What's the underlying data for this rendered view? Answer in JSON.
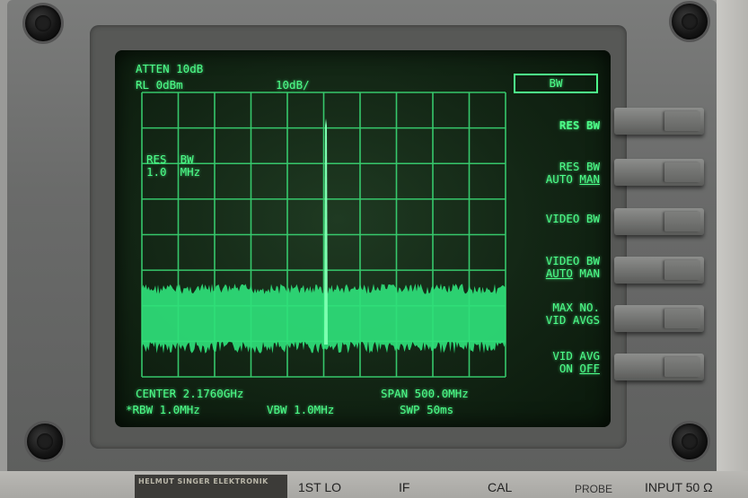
{
  "screen": {
    "atten": "ATTEN 10dB",
    "ref_level": "RL 0dBm",
    "scale": "10dB/",
    "marker_label_1": "RES  BW",
    "marker_label_2": "1.0  MHz",
    "center": "CENTER 2.1760GHz",
    "span": "SPAN 500.0MHz",
    "rbw": "*RBW 1.0MHz",
    "vbw": "VBW 1.0MHz",
    "sweep": "SWP 50ms"
  },
  "menu": {
    "title": "BW",
    "keys": [
      {
        "line1": "RES BW",
        "line2a": "",
        "line2b": ""
      },
      {
        "line1": "RES  BW",
        "line2a": "AUTO ",
        "line2b": "MAN"
      },
      {
        "line1": "VIDEO BW",
        "line2a": "",
        "line2b": ""
      },
      {
        "line1": "VIDEO BW",
        "line2a": "AUTO",
        "line2b": " MAN"
      },
      {
        "line1": "MAX NO.",
        "line2a": "VID AVGS",
        "line2b": ""
      },
      {
        "line1": "VID  AVG",
        "line2a": "ON  ",
        "line2b": "OFF"
      }
    ]
  },
  "panel": {
    "badge": "HELMUT SINGER ELEKTRONIK",
    "connectors": [
      "1ST LO",
      "IF",
      "CAL",
      "PROBE",
      "INPUT 50 Ω"
    ]
  },
  "colors": {
    "phosphor": "#4dff8a",
    "trace_fill": "#2fe07a"
  }
}
